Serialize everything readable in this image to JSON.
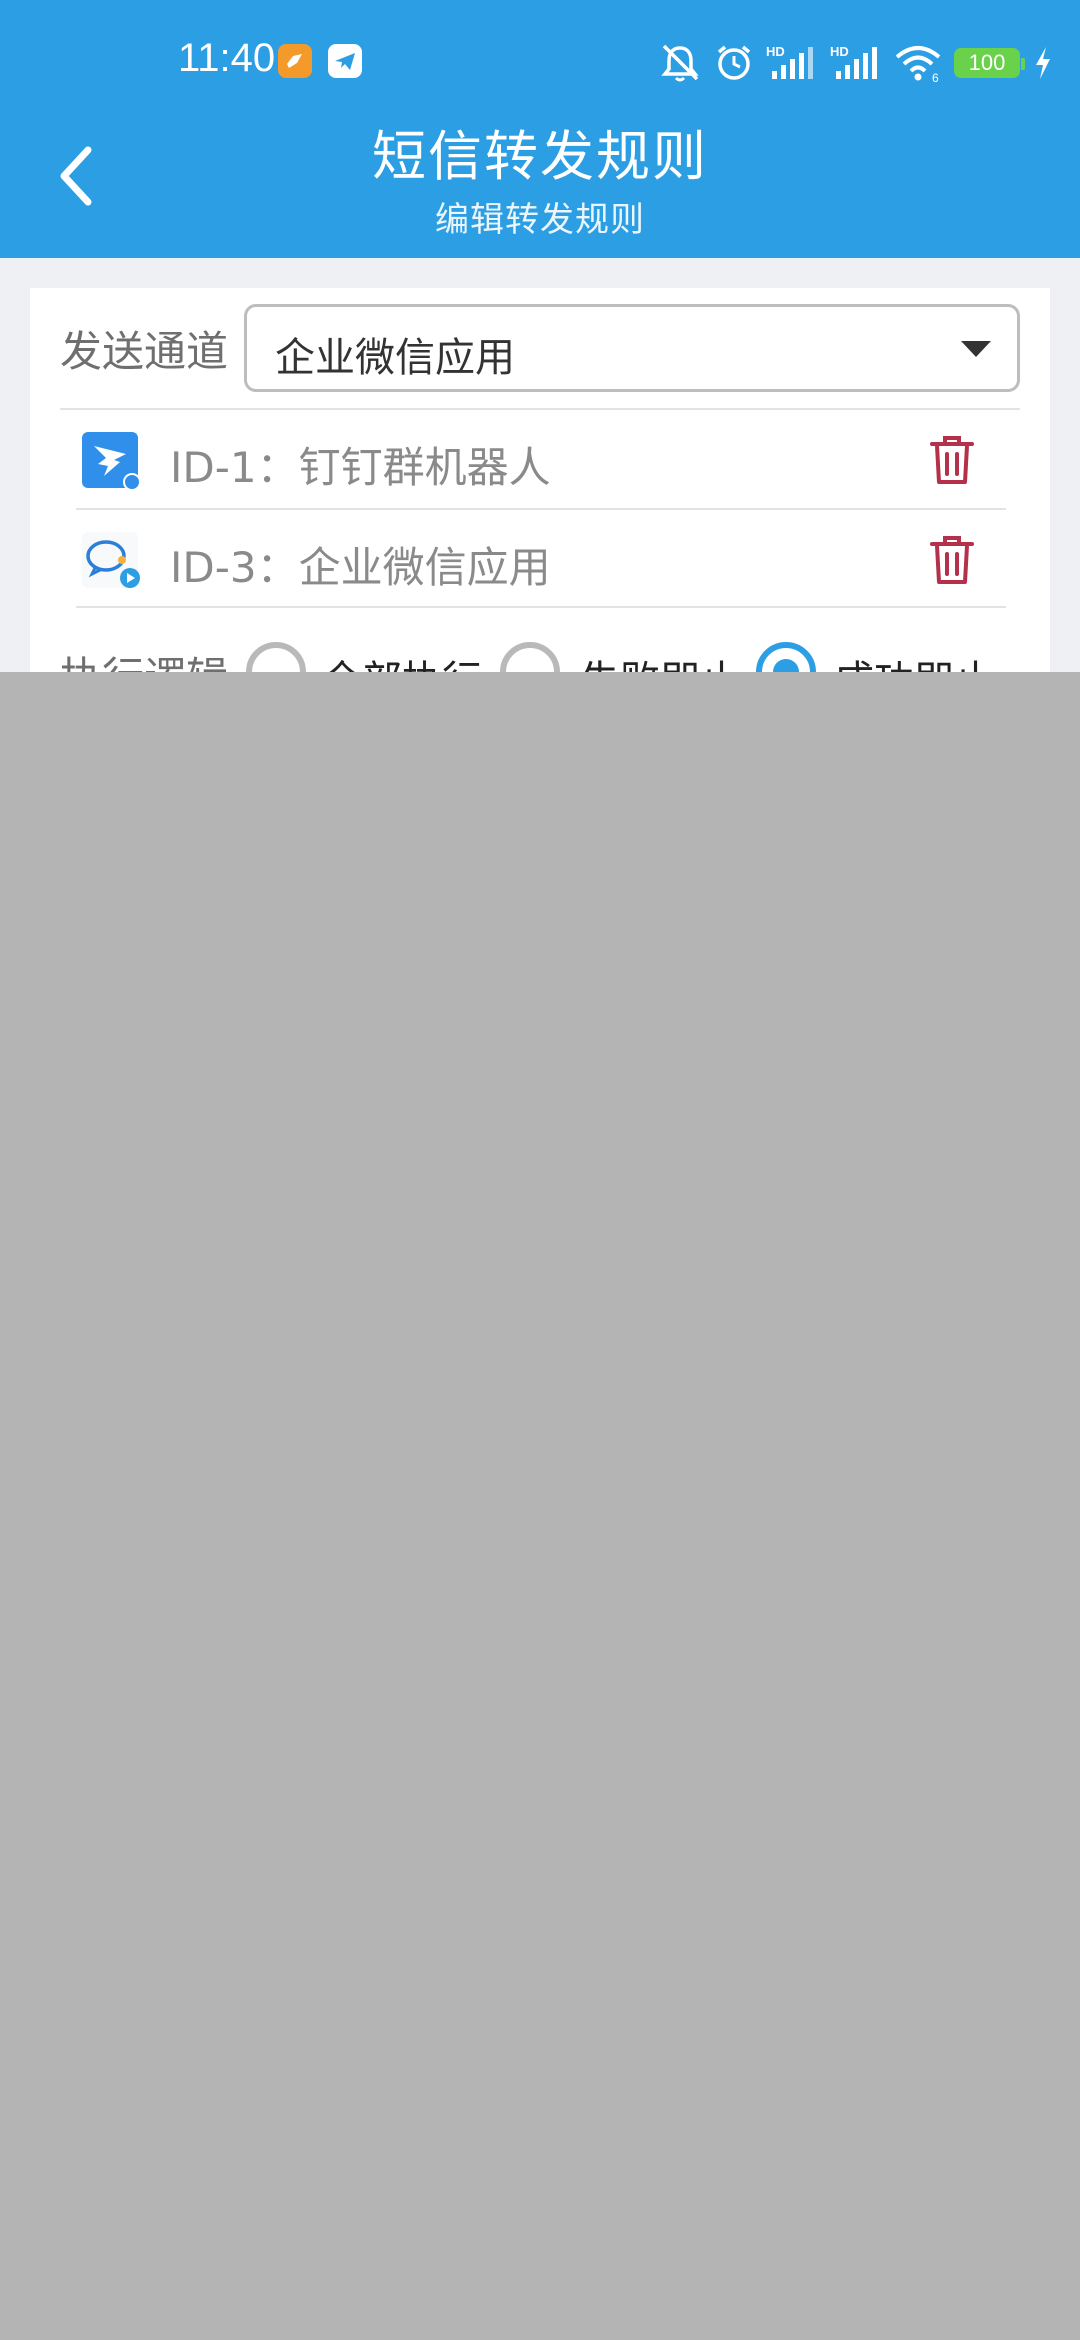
{
  "status_bar": {
    "time": "11:40",
    "battery": "100",
    "network_1": "HD",
    "network_2": "HD",
    "icons": [
      "app-badge-orange",
      "app-badge-plane",
      "mute-bell-icon",
      "alarm-icon",
      "signal-1-icon",
      "signal-2-icon",
      "wifi-icon",
      "battery-icon",
      "charging-icon"
    ]
  },
  "header": {
    "title": "短信转发规则",
    "subtitle": "编辑转发规则",
    "back_icon": "chevron-left-icon",
    "background": "#2c9ee3"
  },
  "form": {
    "channel_label": "发送通道",
    "channel_selected": "企业微信应用",
    "channels": [
      {
        "label": "ID-1：钉钉群机器人",
        "icon": "dingtalk-icon"
      },
      {
        "label": "ID-3：企业微信应用",
        "icon": "wecom-icon"
      }
    ],
    "logic_label": "执行逻辑",
    "logic_options": [
      {
        "label": "全部执行",
        "checked": false
      },
      {
        "label": "失败即止",
        "checked": false
      },
      {
        "label": "成功即止",
        "checked": true
      }
    ],
    "delete_color": "#b5304a",
    "accent": "#2c9ee3"
  }
}
